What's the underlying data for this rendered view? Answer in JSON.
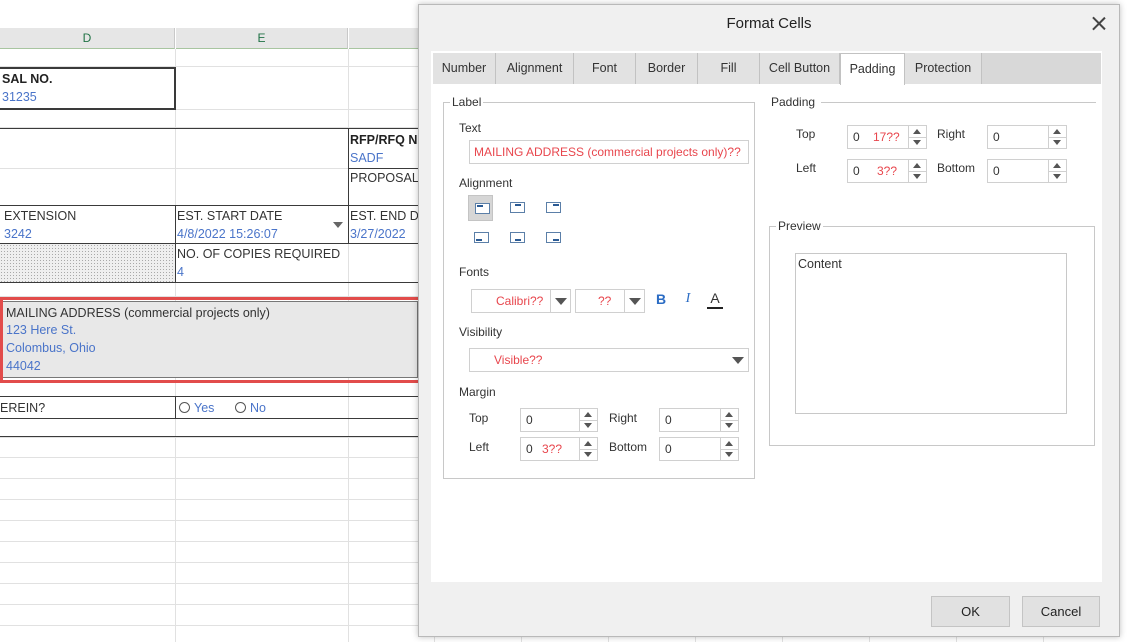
{
  "sheet": {
    "columns": [
      "D",
      "E"
    ],
    "proposal_no_label": "SAL NO.",
    "proposal_no_value": "31235",
    "rfp_label": "RFP/RFQ N",
    "rfp_value": "SADF",
    "proposal_label": "PROPOSAL",
    "extension_label": "EXTENSION",
    "extension_value": "3242",
    "est_start_label": "EST. START DATE",
    "est_start_value": "4/8/2022 15:26:07",
    "est_end_label": "EST. END DA",
    "est_end_value": "3/27/2022",
    "copies_label": "NO. OF COPIES REQUIRED",
    "copies_value": "4",
    "mailing_label": "MAILING ADDRESS (commercial projects only)",
    "mailing_line1": "123 Here St.",
    "mailing_line2": "Colombus, Ohio",
    "mailing_line3": "44042",
    "question_label": "EREIN?",
    "yes_label": "Yes",
    "no_label": "No"
  },
  "dialog": {
    "title": "Format Cells",
    "tabs": [
      "Number",
      "Alignment",
      "Font",
      "Border",
      "Fill",
      "Cell Button",
      "Padding",
      "Protection"
    ],
    "active_tab": "Padding",
    "label_group": {
      "title": "Label",
      "text_label": "Text",
      "text_value": "MAILING ADDRESS (commercial projects only)??",
      "alignment_label": "Alignment",
      "fonts_label": "Fonts",
      "font_name": "Calibri??",
      "font_size": "??",
      "bold_glyph": "B",
      "italic_glyph": "I",
      "color_glyph": "A",
      "visibility_label": "Visibility",
      "visibility_value": "Visible??",
      "margin_label": "Margin",
      "margin": {
        "top_label": "Top",
        "top_value": "0",
        "right_label": "Right",
        "right_value": "0",
        "left_label": "Left",
        "left_value": "0",
        "left_extra": "3??",
        "bottom_label": "Bottom",
        "bottom_value": "0"
      }
    },
    "padding_group": {
      "title": "Padding",
      "top_label": "Top",
      "top_value": "0",
      "top_extra": "17??",
      "right_label": "Right",
      "right_value": "0",
      "left_label": "Left",
      "left_value": "0",
      "left_extra": "3??",
      "bottom_label": "Bottom",
      "bottom_value": "0"
    },
    "preview_group": {
      "title": "Preview",
      "content": "Content"
    },
    "ok_label": "OK",
    "cancel_label": "Cancel"
  },
  "colors": {
    "accent_red": "#e8464d",
    "value_blue": "#4a74c9",
    "header_green": "#217346",
    "highlight_border": "#e24c4b"
  }
}
